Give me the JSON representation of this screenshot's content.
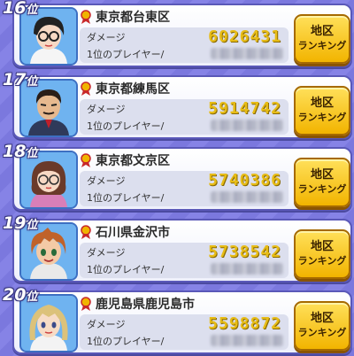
{
  "rank_suffix": "位",
  "damage_label": "ダメージ",
  "top_player_label": "1位のプレイヤー/",
  "button_line1": "地区",
  "button_line2": "ランキング",
  "entries": [
    {
      "rank": "16",
      "area": "東京都台東区",
      "damage": "6026431"
    },
    {
      "rank": "17",
      "area": "東京都練馬区",
      "damage": "5914742"
    },
    {
      "rank": "18",
      "area": "東京都文京区",
      "damage": "5740386"
    },
    {
      "rank": "19",
      "area": "石川県金沢市",
      "damage": "5738542"
    },
    {
      "rank": "20",
      "area": "鹿児島県鹿児島市",
      "damage": "5598872"
    }
  ]
}
